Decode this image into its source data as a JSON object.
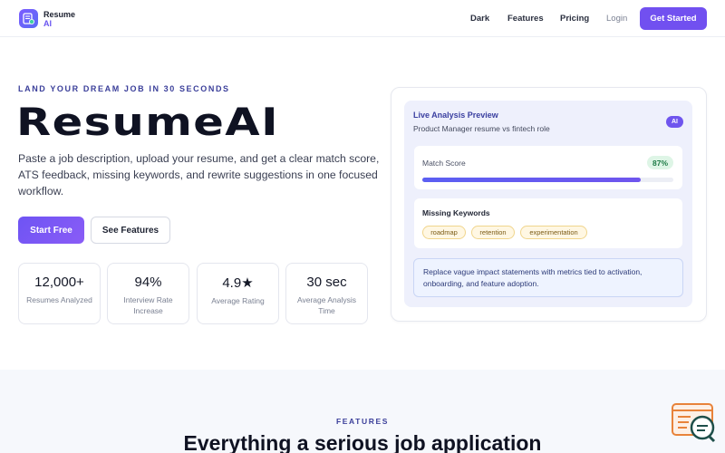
{
  "header": {
    "logo_line1": "Resume",
    "logo_line2": "AI",
    "nav": [
      "Dark",
      "Features",
      "Pricing"
    ],
    "login": "Login",
    "cta": "Get Started"
  },
  "hero": {
    "eyebrow": "LAND YOUR DREAM JOB IN 30 SECONDS",
    "title": "ResumeAI",
    "description": "Paste a job description, upload your resume, and get a clear match score, ATS feedback, missing keywords, and rewrite suggestions in one focused workflow.",
    "primary_btn": "Start Free",
    "secondary_btn": "See Features",
    "stats": [
      {
        "value": "12,000+",
        "label": "Resumes Analyzed"
      },
      {
        "value": "94%",
        "label": "Interview Rate Increase"
      },
      {
        "value": "4.9★",
        "label": "Average Rating"
      },
      {
        "value": "30 sec",
        "label": "Average Analysis Time"
      }
    ]
  },
  "preview": {
    "title": "Live Analysis Preview",
    "subtitle": "Product Manager resume vs fintech role",
    "badge": "AI",
    "match_label": "Match Score",
    "match_value": "87%",
    "match_fraction": 0.87,
    "keywords_title": "Missing Keywords",
    "keywords": [
      "roadmap",
      "retention",
      "experimentation"
    ],
    "suggestion": "Replace vague impact statements with metrics tied to activation, onboarding, and feature adoption."
  },
  "features": {
    "eyebrow": "FEATURES",
    "title": "Everything a serious job application"
  },
  "colors": {
    "accent": "#7150f0",
    "success_bg": "#def5e6",
    "chip_bg": "#fff7e3"
  }
}
